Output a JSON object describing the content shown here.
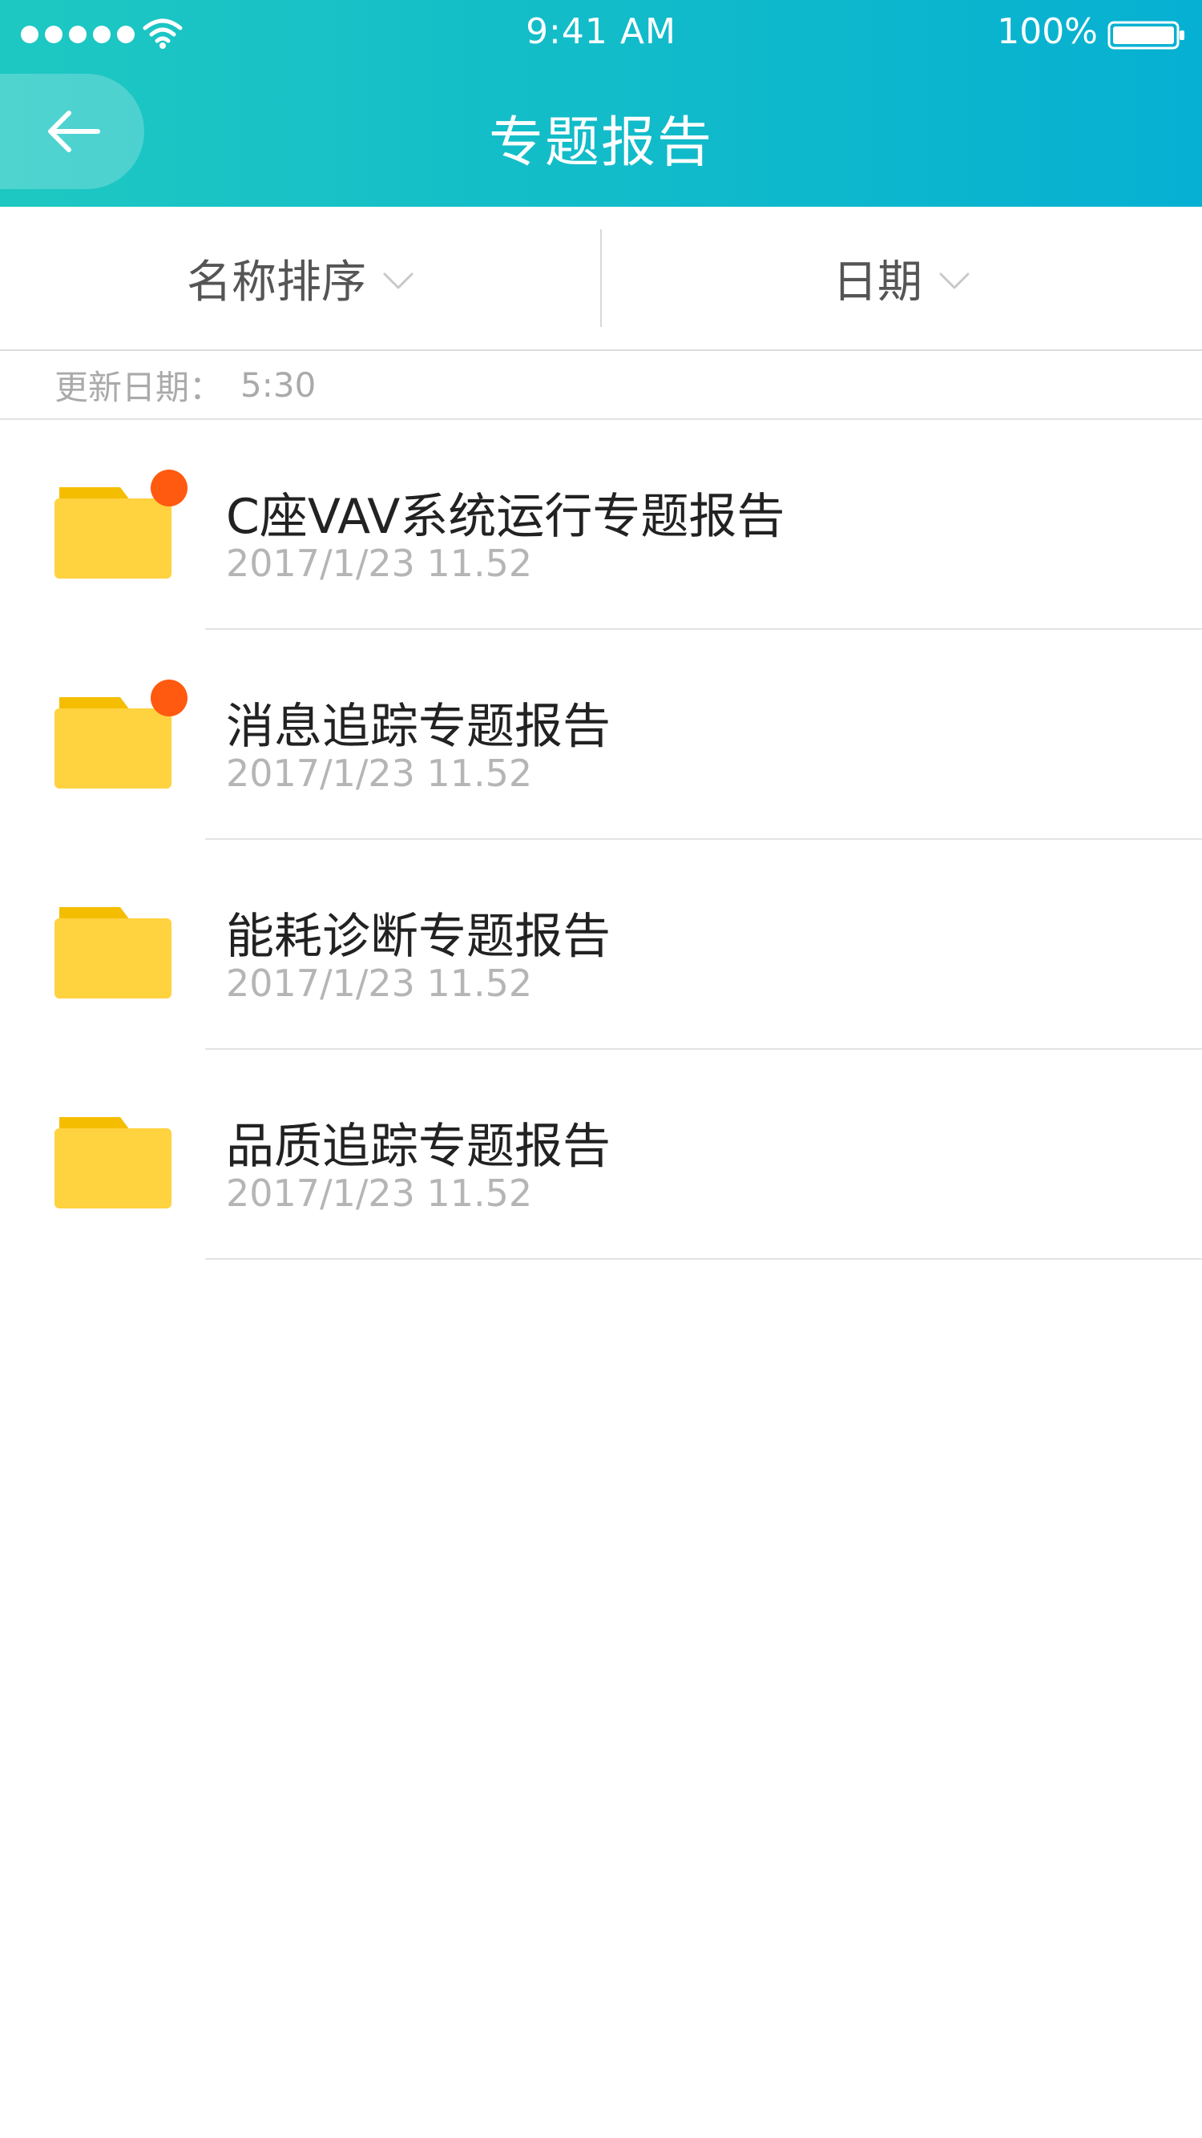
{
  "status_bar": {
    "time": "9:41 AM",
    "battery_percent": "100%",
    "icons": [
      "signal-dots-icon",
      "wifi-icon",
      "battery-icon"
    ]
  },
  "nav": {
    "title": "专题报告",
    "back_icon": "arrow-left-icon"
  },
  "filters": {
    "name_sort_label": "名称排序",
    "date_label": "日期",
    "dropdown_icon": "chevron-down-icon"
  },
  "update": {
    "label": "更新日期：",
    "value": "5:30"
  },
  "reports": [
    {
      "title": "C座VAV系统运行专题报告",
      "date": "2017/1/23 11.52",
      "unread": true
    },
    {
      "title": "消息追踪专题报告",
      "date": "2017/1/23 11.52",
      "unread": true
    },
    {
      "title": "能耗诊断专题报告",
      "date": "2017/1/23 11.52",
      "unread": false
    },
    {
      "title": "品质追踪专题报告",
      "date": "2017/1/23 11.52",
      "unread": false
    }
  ],
  "colors": {
    "header_gradient_start": "#1ec8c2",
    "header_gradient_end": "#06b0d2",
    "folder": "#ffd23f",
    "folder_tab": "#f5bd00",
    "unread_dot": "#ff5a0f"
  }
}
